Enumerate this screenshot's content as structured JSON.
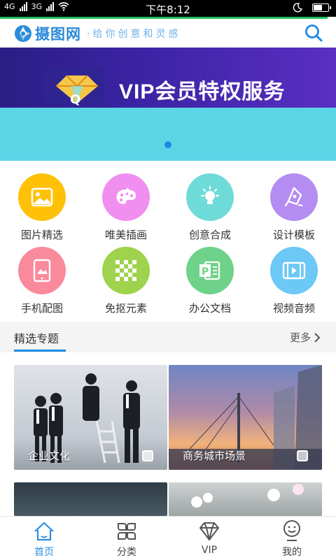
{
  "status_bar": {
    "net1": "4G",
    "net2": "3G",
    "time": "下午8:12",
    "battery_level": 0.6
  },
  "header": {
    "brand": "摄图网",
    "slogan": "·给你创意和灵感",
    "search_icon": "search-icon"
  },
  "banner": {
    "text": "VIP会员特权服务",
    "colors": {
      "top": "#3a23a3",
      "bottom": "#5cd5e6",
      "dot": "#1e88e5"
    }
  },
  "categories": [
    {
      "label": "图片精选",
      "icon": "picture-icon",
      "color": "#ffc107"
    },
    {
      "label": "唯美插画",
      "icon": "palette-icon",
      "color": "#f08ff0"
    },
    {
      "label": "创意合成",
      "icon": "bulb-icon",
      "color": "#6fdbd8"
    },
    {
      "label": "设计模板",
      "icon": "pen-icon",
      "color": "#b48cf2"
    },
    {
      "label": "手机配图",
      "icon": "phone-picture-icon",
      "color": "#f98a9c"
    },
    {
      "label": "免抠元素",
      "icon": "checker-icon",
      "color": "#9fd24d"
    },
    {
      "label": "办公文档",
      "icon": "ppt-icon",
      "color": "#6fd28a"
    },
    {
      "label": "视频音频",
      "icon": "video-icon",
      "color": "#6cc8f5"
    }
  ],
  "section": {
    "title": "精选专题",
    "more": "更多"
  },
  "cards": [
    {
      "caption": "企业文化"
    },
    {
      "caption": "商务城市场景"
    },
    {
      "caption": ""
    },
    {
      "caption": ""
    }
  ],
  "tabs": [
    {
      "label": "首页",
      "icon": "home-icon",
      "active": true
    },
    {
      "label": "分类",
      "icon": "category-icon",
      "active": false
    },
    {
      "label": "VIP",
      "icon": "diamond-icon",
      "active": false
    },
    {
      "label": "我的",
      "icon": "profile-icon",
      "active": false
    }
  ]
}
